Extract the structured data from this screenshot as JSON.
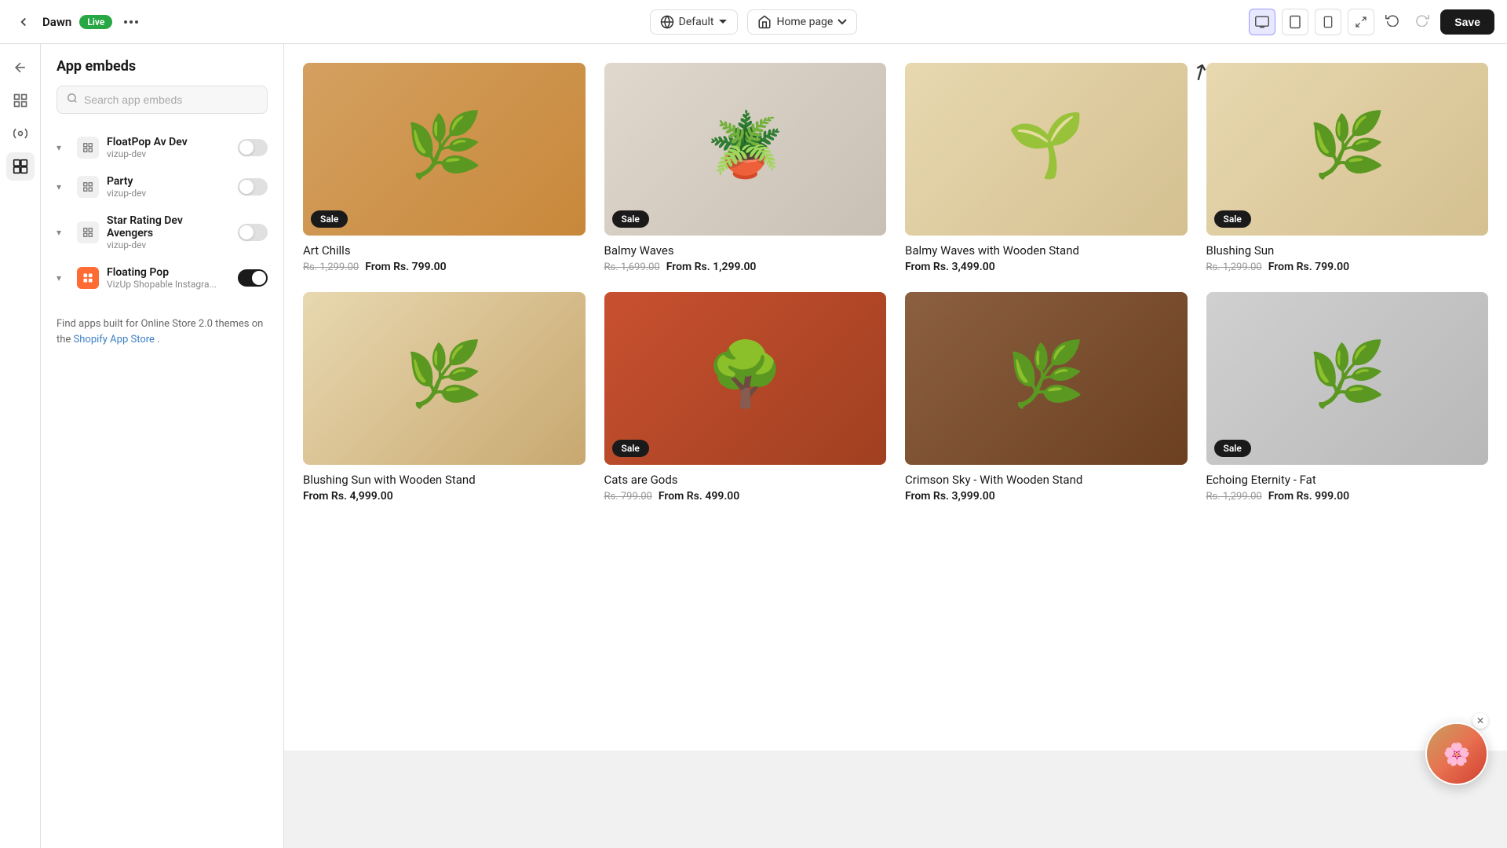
{
  "topbar": {
    "back_icon": "←",
    "store_name": "Dawn",
    "live_label": "Live",
    "more_icon": "•••",
    "theme_label": "Default",
    "page_label": "Home page",
    "save_label": "Save"
  },
  "sidebar_icons": [
    {
      "name": "back-nav-icon",
      "icon": "↩"
    },
    {
      "name": "grid-icon",
      "icon": "⊞"
    },
    {
      "name": "settings-icon",
      "icon": "⚙"
    },
    {
      "name": "apps-icon",
      "icon": "⊡",
      "active": true
    }
  ],
  "panel": {
    "title": "App embeds",
    "search_placeholder": "Search app embeds",
    "embeds": [
      {
        "name": "FloatPop Av Dev",
        "dev": "vizup-dev",
        "enabled": false
      },
      {
        "name": "Party",
        "dev": "vizup-dev",
        "enabled": false
      },
      {
        "name": "Star Rating Dev Avengers",
        "dev": "vizup-dev",
        "enabled": false
      },
      {
        "name": "Floating Pop",
        "dev": "VizUp Shopable Instagra...",
        "enabled": true,
        "orange": true
      }
    ],
    "footer_text": "Find apps built for Online Store 2.0 themes on the ",
    "footer_link_label": "Shopify App Store",
    "footer_suffix": "."
  },
  "products": [
    {
      "name": "Art Chills",
      "sale": true,
      "original_price": "Rs. 1,299.00",
      "sale_price": "From Rs. 799.00",
      "bg": "art-chills"
    },
    {
      "name": "Balmy Waves",
      "sale": true,
      "original_price": "Rs. 1,699.00",
      "sale_price": "From Rs. 1,299.00",
      "bg": "balmy-waves"
    },
    {
      "name": "Balmy Waves with Wooden Stand",
      "sale": false,
      "regular_price": "From Rs. 3,499.00",
      "bg": "balmy-waves-stand"
    },
    {
      "name": "Blushing Sun",
      "sale": true,
      "original_price": "Rs. 1,299.00",
      "sale_price": "From Rs. 799.00",
      "bg": "blushing-sun"
    },
    {
      "name": "Blushing Sun with Wooden Stand",
      "sale": false,
      "regular_price": "From Rs. 4,999.00",
      "bg": "blushing-sun-stand"
    },
    {
      "name": "Cats are Gods",
      "sale": true,
      "original_price": "Rs. 799.00",
      "sale_price": "From Rs. 499.00",
      "bg": "cats-gods"
    },
    {
      "name": "Crimson Sky - With Wooden Stand",
      "sale": false,
      "regular_price": "From Rs. 3,999.00",
      "bg": "crimson-sky"
    },
    {
      "name": "Echoing Eternity - Fat",
      "sale": true,
      "original_price": "Rs. 1,299.00",
      "sale_price": "From Rs. 999.00",
      "bg": "echoing"
    }
  ],
  "plant_emojis": {
    "art-chills": "🌿",
    "balmy-waves": "🪴",
    "balmy-waves-stand": "🌱",
    "blushing-sun": "🌿",
    "blushing-sun-stand": "🌿",
    "cats-gods": "🌳",
    "crimson-sky": "🌿",
    "echoing": "🌿"
  }
}
